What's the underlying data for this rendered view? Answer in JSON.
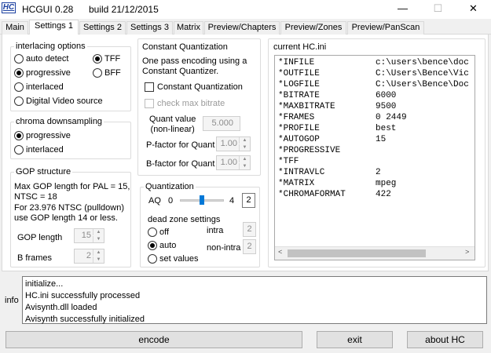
{
  "window": {
    "logo": "HC",
    "title": "HCGUI 0.28",
    "build": "build 21/12/2015",
    "minimize": "—",
    "maximize": "☐",
    "close": "✕"
  },
  "tabs": [
    "Main",
    "Settings 1",
    "Settings 2",
    "Settings 3",
    "Matrix",
    "Preview/Chapters",
    "Preview/Zones",
    "Preview/PanScan"
  ],
  "active_tab": "Settings 1",
  "interlacing": {
    "title": "interlacing options",
    "auto_detect": "auto detect",
    "progressive": "progressive",
    "interlaced": "interlaced",
    "dvs": "Digital Video source",
    "tff": "TFF",
    "bff": "BFF",
    "selected": "progressive",
    "field_order": "TFF"
  },
  "chroma": {
    "title": "chroma downsampling",
    "progressive": "progressive",
    "interlaced": "interlaced",
    "selected": "progressive"
  },
  "gop": {
    "title": "GOP structure",
    "desc1": "Max GOP length for PAL = 15,",
    "desc2": "NTSC = 18",
    "desc3": "For 23.976 NTSC (pulldown)",
    "desc4": "use GOP length 14 or less.",
    "length_label": "GOP length",
    "length_value": "15",
    "bframes_label": "B frames",
    "bframes_value": "2"
  },
  "cq": {
    "title": "Constant Quantization",
    "desc1": "One pass encoding using a",
    "desc2": "Constant Quantizer.",
    "cq_label": "Constant Quantization",
    "maxbr_label": "check max bitrate",
    "qv_label1": "Quant value",
    "qv_label2": "(non-linear)",
    "qv_value": "5.000",
    "pf_label": "P-factor for Quant",
    "pf_value": "1.00",
    "bf_label": "B-factor for Quant",
    "bf_value": "1.00"
  },
  "quant": {
    "title": "Quantization",
    "aq_label": "AQ",
    "aq_min": "0",
    "aq_max": "4",
    "aq_value": "2",
    "aq_level": 0.5,
    "dz_title": "dead zone settings",
    "off": "off",
    "auto": "auto",
    "set_values": "set values",
    "selected": "auto",
    "intra_label": "intra",
    "intra_value": "2",
    "nonintra_label": "non-intra",
    "nonintra_value": "2"
  },
  "ini": {
    "title": "current HC.ini",
    "lines": [
      {
        "key": "*INFILE",
        "val": "c:\\users\\bence\\doc"
      },
      {
        "key": "*OUTFILE",
        "val": "C:\\Users\\Bence\\Vic"
      },
      {
        "key": "*LOGFILE",
        "val": "C:\\Users\\Bence\\Doc"
      },
      {
        "key": "*BITRATE",
        "val": "6000"
      },
      {
        "key": "*MAXBITRATE",
        "val": "9500"
      },
      {
        "key": "*FRAMES",
        "val": "0 2449"
      },
      {
        "key": "*PROFILE",
        "val": "best"
      },
      {
        "key": "*AUTOGOP",
        "val": "15"
      },
      {
        "key": "*PROGRESSIVE",
        "val": ""
      },
      {
        "key": "*TFF",
        "val": ""
      },
      {
        "key": "*INTRAVLC",
        "val": "2"
      },
      {
        "key": "*MATRIX",
        "val": "mpeg"
      },
      {
        "key": "*CHROMAFORMAT",
        "val": "422"
      }
    ]
  },
  "info": {
    "label": "info",
    "lines": [
      "initialize...",
      "HC.ini successfully processed",
      "Avisynth.dll loaded",
      "Avisynth successfully initialized"
    ]
  },
  "buttons": {
    "encode": "encode",
    "exit": "exit",
    "about": "about HC"
  },
  "colors": {
    "accent": "#0078d7",
    "logo": "#1a3fa0"
  }
}
